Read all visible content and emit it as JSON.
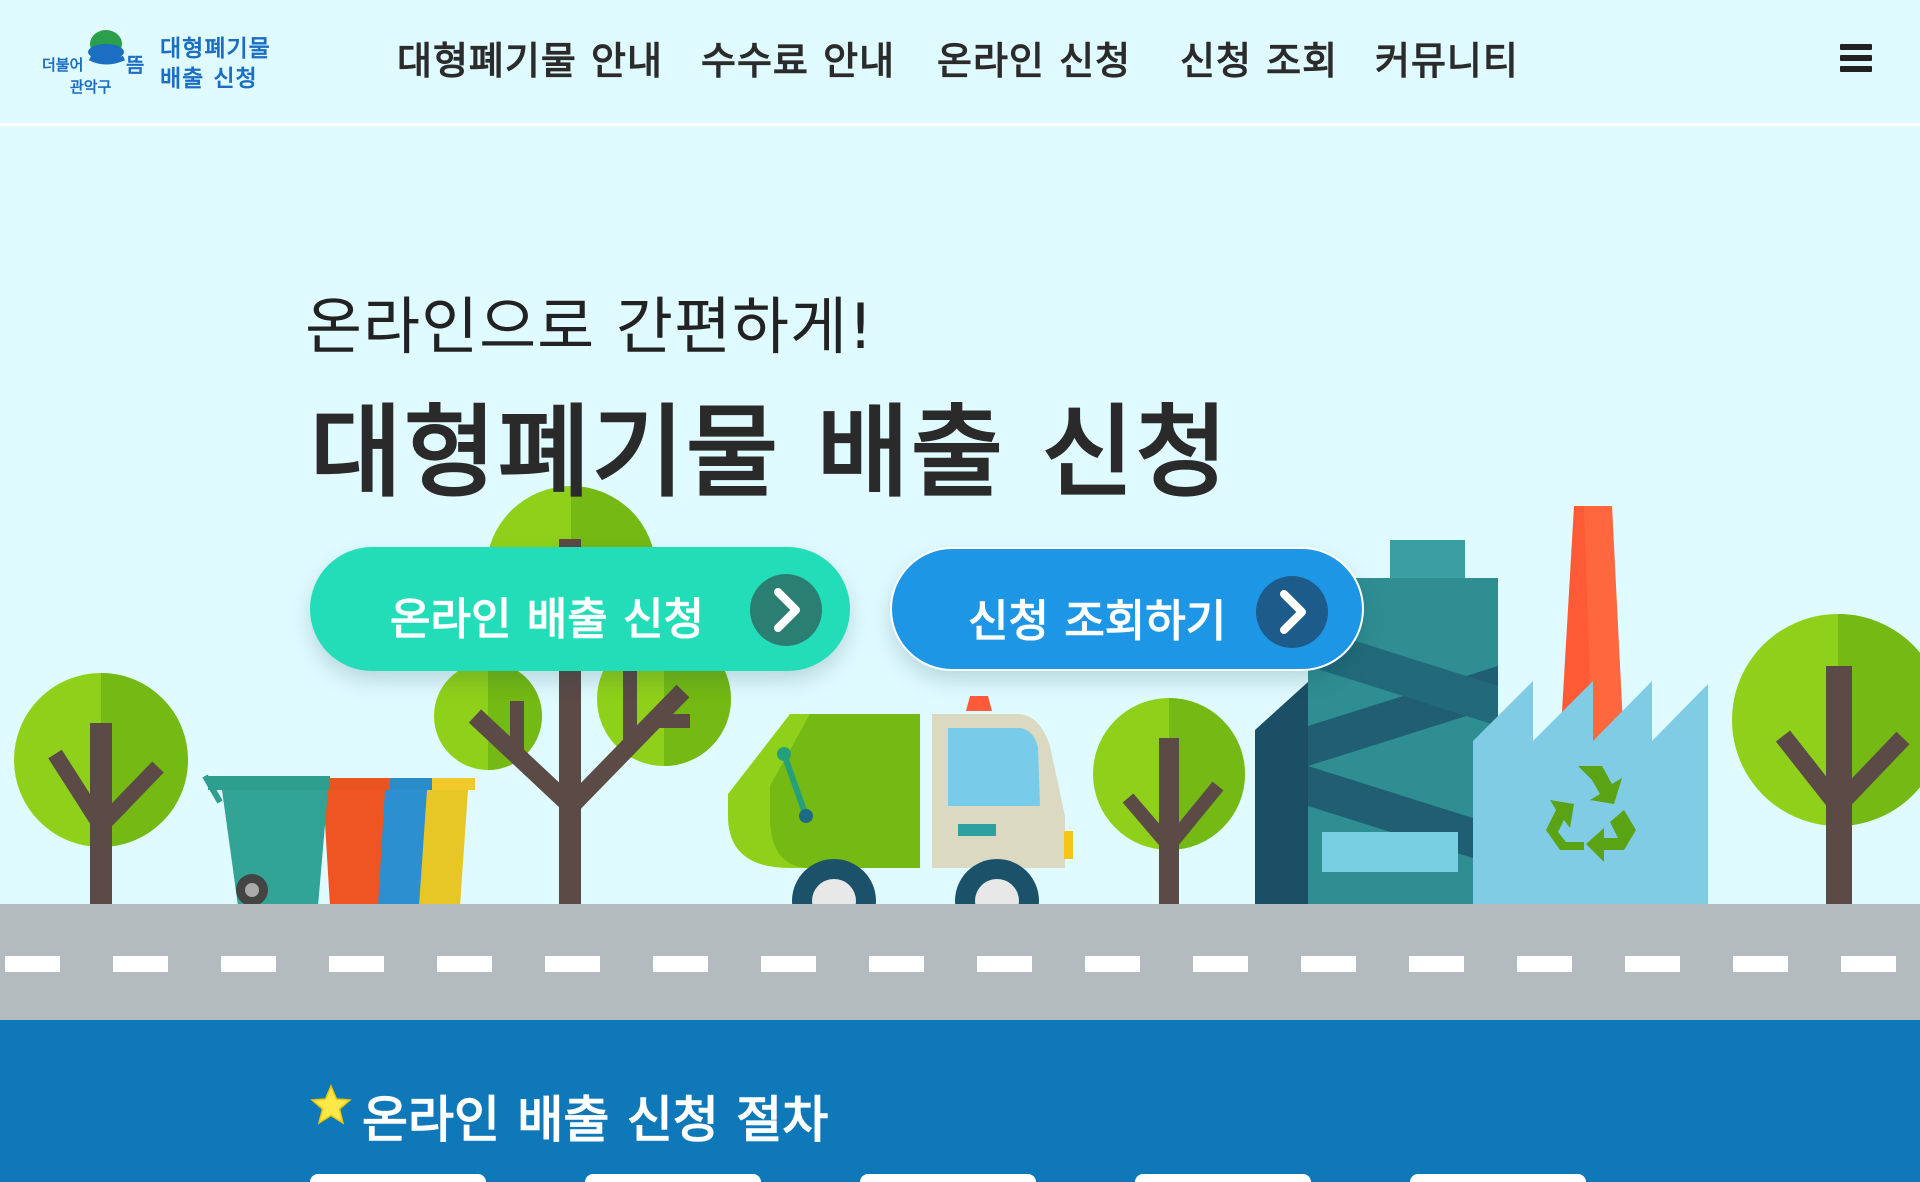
{
  "header": {
    "logo": {
      "slogan_text": "더불어 으뜸 관악구",
      "line1": "대형폐기물",
      "line2": "배출 신청"
    },
    "nav": [
      {
        "label": "대형폐기물 안내"
      },
      {
        "label": "수수료 안내"
      },
      {
        "label": "온라인 신청"
      },
      {
        "label": "신청 조회"
      },
      {
        "label": "커뮤니티"
      }
    ],
    "menu_icon": "hamburger-menu-icon"
  },
  "hero": {
    "subtitle": "온라인으로 간편하게!",
    "title": "대형폐기물 배출 신청",
    "buttons": {
      "online": {
        "label": "온라인 배출 신청",
        "icon": "chevron-right-icon"
      },
      "lookup": {
        "label": "신청 조회하기",
        "icon": "chevron-right-icon"
      }
    }
  },
  "procedure": {
    "title": "온라인 배출 신청 절차",
    "icon": "star-icon"
  },
  "colors": {
    "background": "#e0fbff",
    "accent_green": "#22ddb8",
    "accent_blue": "#1e96e6",
    "section_blue": "#0e78b8",
    "road": "#b3bbbf"
  }
}
